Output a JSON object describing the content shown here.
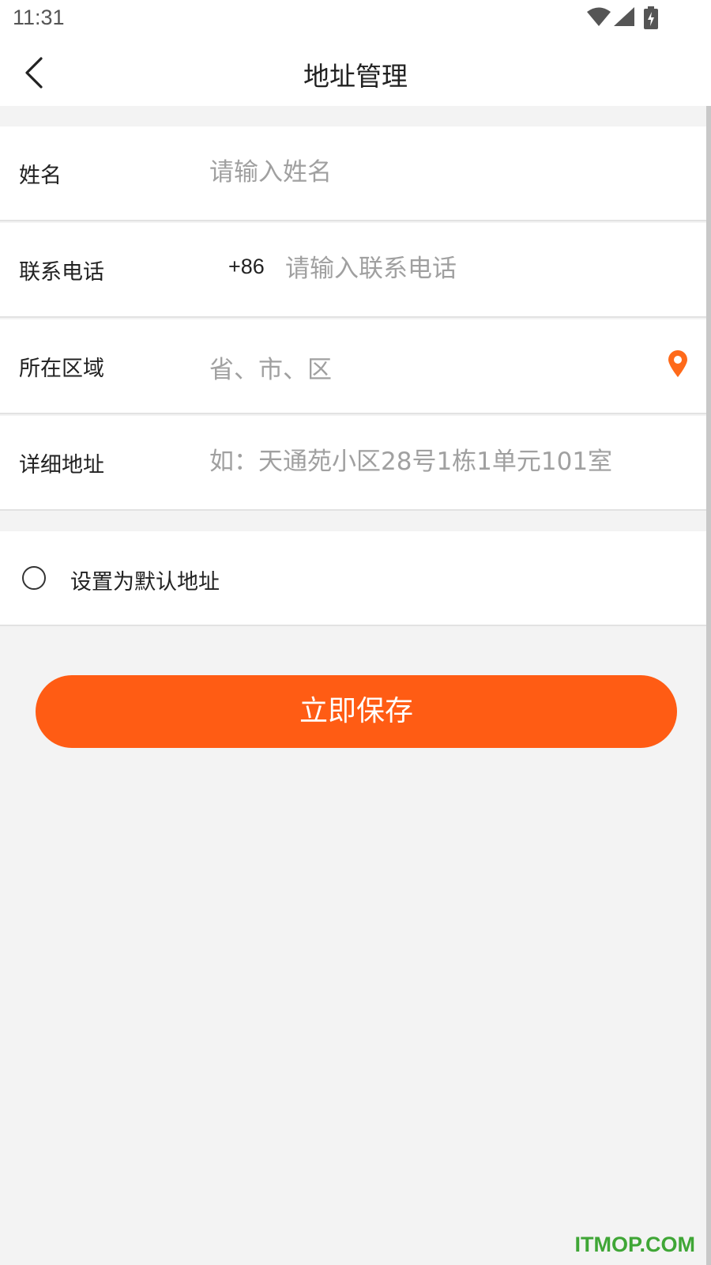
{
  "status_bar": {
    "time": "11:31",
    "icons": [
      "wifi-icon",
      "signal-icon",
      "battery-charging-icon"
    ]
  },
  "header": {
    "title": "地址管理",
    "back_icon": "chevron-left-icon"
  },
  "form": {
    "name": {
      "label": "姓名",
      "placeholder": "请输入姓名",
      "value": ""
    },
    "phone": {
      "label": "联系电话",
      "prefix": "+86",
      "placeholder": "请输入联系电话",
      "value": ""
    },
    "region": {
      "label": "所在区域",
      "placeholder": "省、市、区",
      "icon": "location-pin-icon"
    },
    "detail": {
      "label": "详细地址",
      "placeholder": "如：天通苑小区28号1栋1单元101室",
      "value": ""
    }
  },
  "default_address": {
    "label": "设置为默认地址",
    "checked": false
  },
  "save_button": {
    "label": "立即保存"
  },
  "watermark": "ITMOP.COM",
  "colors": {
    "accent": "#ff5c14",
    "background": "#f3f3f3",
    "watermark": "#3fa636"
  }
}
